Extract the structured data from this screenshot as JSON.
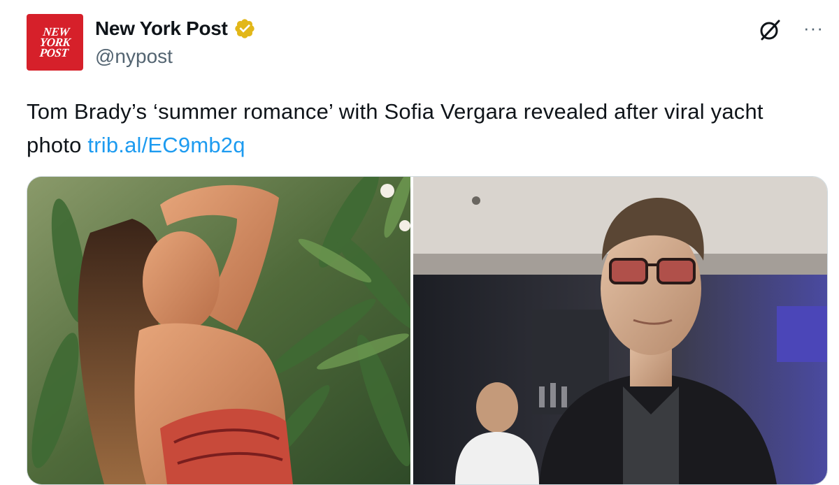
{
  "account": {
    "logo_text": "NEW\nYORK\nPOST",
    "display_name": "New York Post",
    "handle": "@nypost",
    "verified_icon": "verified-badge-gold",
    "brand_color": "#d6202a"
  },
  "toolbar": {
    "grok_icon": "grok-icon",
    "more_label": "···"
  },
  "tweet": {
    "text": "Tom Brady’s ‘summer romance’ with Sofia Vergara revealed after viral yacht photo ",
    "link": "trib.al/EC9mb2q",
    "link_color": "#1d9bf0"
  },
  "media": {
    "photos": [
      {
        "subject": "woman posing among tropical foliage"
      },
      {
        "subject": "man in sunglasses and dark shirt"
      }
    ]
  }
}
